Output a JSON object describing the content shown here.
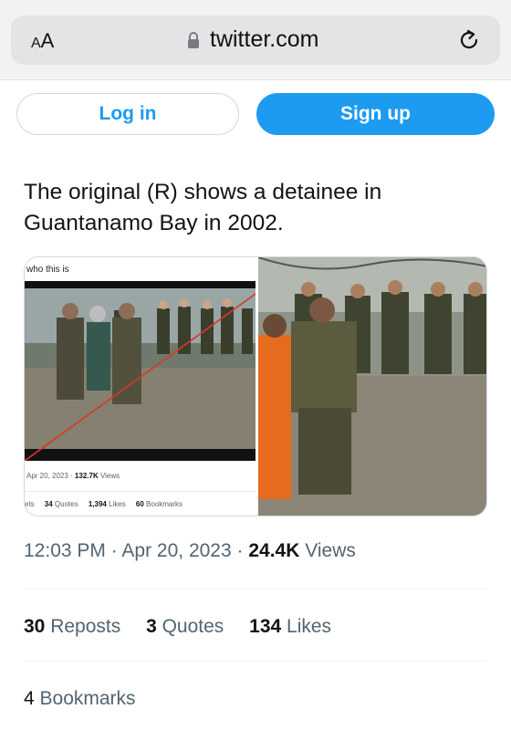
{
  "browser": {
    "text_size_button": {
      "big": "A",
      "small": "A"
    },
    "domain": "twitter.com",
    "lock_icon": "lock-icon",
    "reload_icon": "reload-icon"
  },
  "auth": {
    "login_label": "Log in",
    "signup_label": "Sign up",
    "accent": "#1d9bf0"
  },
  "tweet": {
    "text_line1": "The original (R) shows a detainee in",
    "text_line2": "Guantanamo Bay in 2002.",
    "time": "12:03 PM",
    "sep1": " · ",
    "date": "Apr 20, 2023",
    "sep2": " · ",
    "views_count": "24.4K",
    "views_label": " Views",
    "reposts_count": "30",
    "reposts_label": " Reposts",
    "quotes_count": "3",
    "quotes_label": " Quotes",
    "likes_count": "134",
    "likes_label": " Likes",
    "bookmarks_count": "4",
    "bookmarks_label": " Bookmarks"
  },
  "embedded": {
    "caption": "who this is",
    "meta_date": "Apr 20, 2023 · ",
    "meta_views_count": "132.7K",
    "meta_views_label": " Views",
    "stats_reposts": "ets",
    "quotes_count": "34",
    "quotes_label": " Quotes",
    "likes_count": "1,394",
    "likes_label": " Likes",
    "bookmarks_count": "60",
    "bookmarks_label": " Bookmarks"
  }
}
